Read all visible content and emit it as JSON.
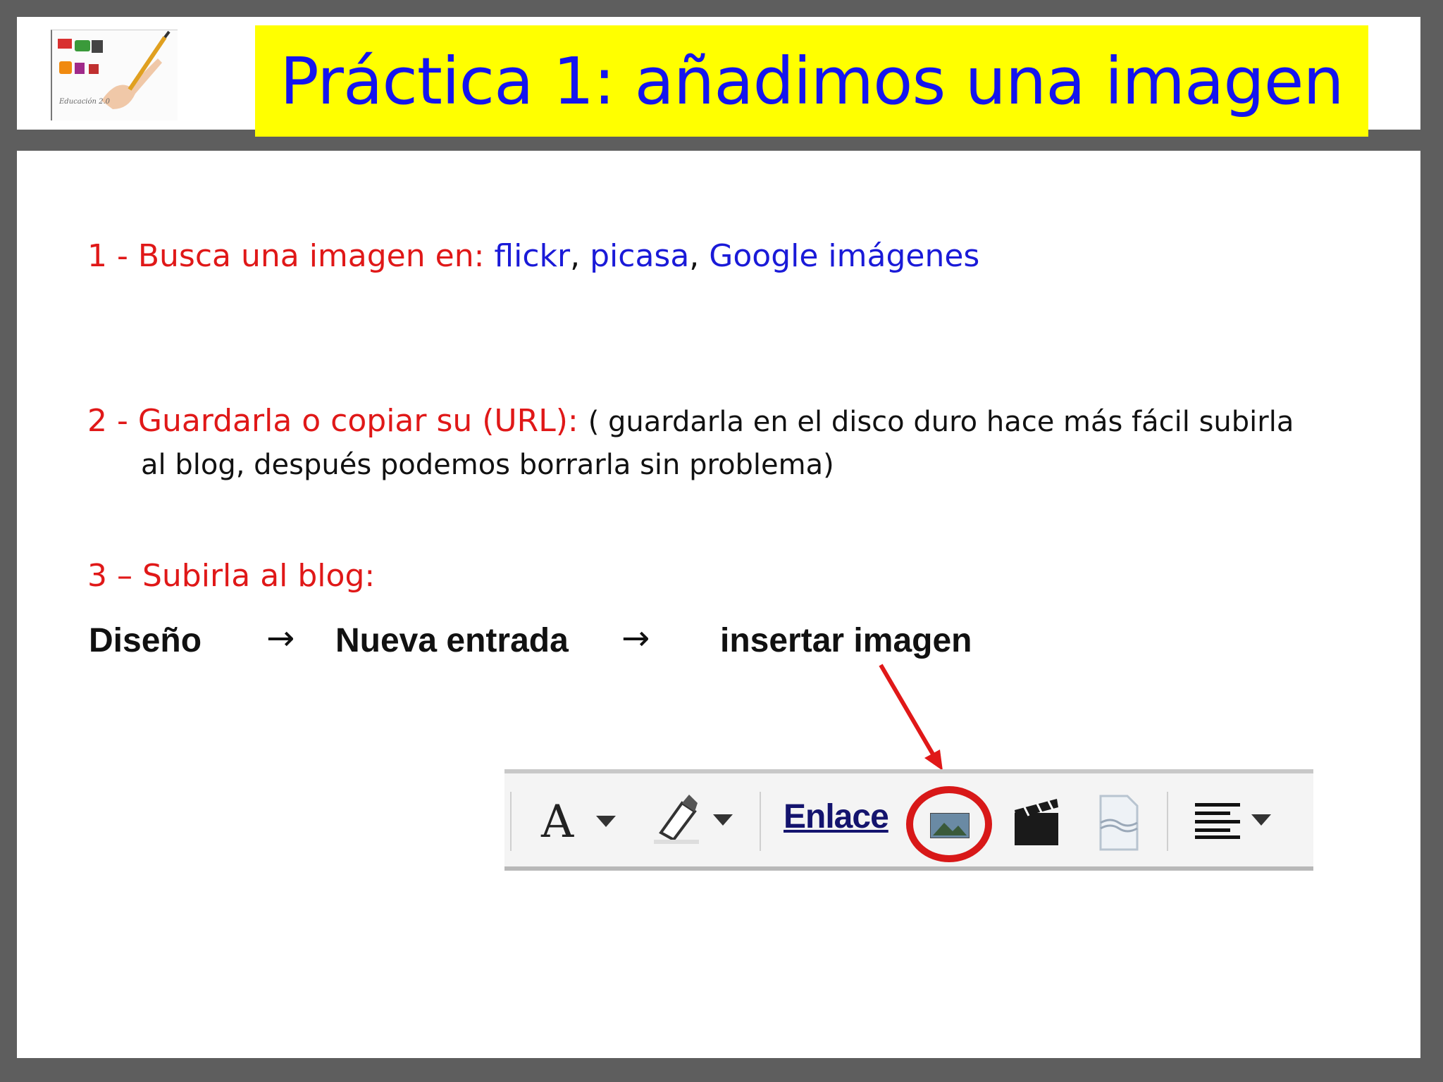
{
  "title": "Práctica 1: añadimos una imagen",
  "logo": {
    "caption": "Educación 2.0"
  },
  "steps": {
    "step1": {
      "prefix": "1 - Busca una imagen en: ",
      "links": [
        "flickr",
        "picasa",
        "Google imágenes"
      ],
      "separator": ", "
    },
    "step2": {
      "prefix": "2 - Guardarla o copiar su (URL): ",
      "note_line1": "( guardarla en el disco duro hace más fácil subirla",
      "note_line2": "al blog, después podemos borrarla sin problema)"
    },
    "step3": {
      "prefix": "3 – Subirla al blog:"
    }
  },
  "path": {
    "items": [
      "Diseño",
      "Nueva entrada",
      "insertar imagen"
    ],
    "arrow": "→"
  },
  "toolbar": {
    "font_glyph": "A",
    "link_label": "Enlace",
    "icons": [
      "font-icon",
      "highlighter-icon",
      "link-icon",
      "insert-image-icon",
      "insert-video-icon",
      "page-break-icon",
      "align-icon"
    ]
  },
  "colors": {
    "title": "#1414ee",
    "title_bg": "#ffff00",
    "step_label": "#e01818",
    "link": "#1a1ad8",
    "highlight_ring": "#d81818"
  }
}
